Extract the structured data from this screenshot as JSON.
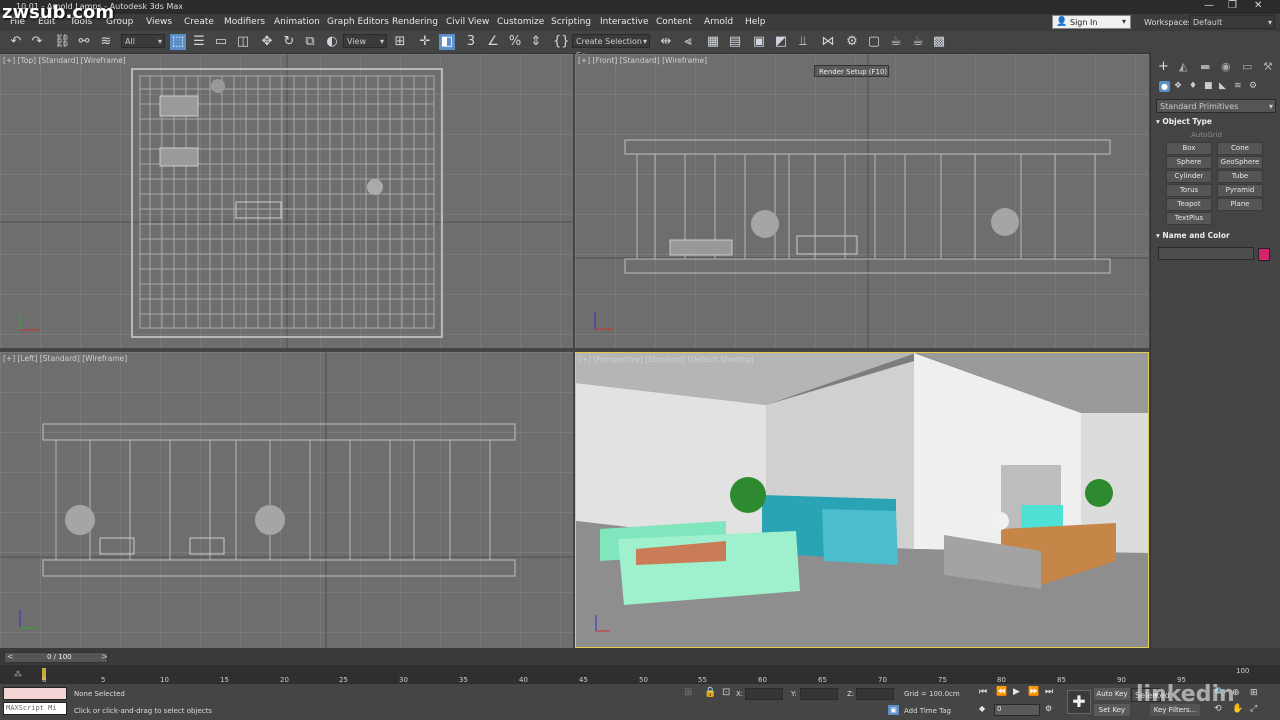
{
  "window": {
    "title": "10.01 - Arnold Lamps - Autodesk 3ds Max",
    "watermark": "zwsub.com"
  },
  "menu": [
    "File",
    "Edit",
    "Tools",
    "Group",
    "Views",
    "Create",
    "Modifiers",
    "Animation",
    "Graph Editors",
    "Rendering",
    "Civil View",
    "Customize",
    "Scripting",
    "Interactive",
    "Content",
    "Arnold",
    "Help"
  ],
  "account": {
    "signin": "Sign In",
    "workspaces_label": "Workspaces:",
    "workspace": "Default"
  },
  "toolbar": {
    "filter": "All",
    "ref_coord": "View",
    "selection_set": "Create Selection Se",
    "tooltip": "Render Setup  (F10)"
  },
  "viewports": {
    "top": "[+] [Top] [Standard] [Wireframe]",
    "front": "[+] [Front] [Standard] [Wireframe]",
    "left": "[+] [Left] [Standard] [Wireframe]",
    "perspective": "[+] [Perspective] [Standard] [Default Shading]"
  },
  "command_panel": {
    "category": "Standard Primitives",
    "object_type_title": "Object Type",
    "autogrid": "AutoGrid",
    "buttons": [
      "Box",
      "Cone",
      "Sphere",
      "GeoSphere",
      "Cylinder",
      "Tube",
      "Torus",
      "Pyramid",
      "Teapot",
      "Plane",
      "TextPlus"
    ],
    "name_color_title": "Name and Color",
    "swatch_color": "#d4246e"
  },
  "timeline": {
    "frame": "0 / 100",
    "ticks": [
      "0",
      "5",
      "10",
      "15",
      "20",
      "25",
      "30",
      "35",
      "40",
      "45",
      "50",
      "55",
      "60",
      "65",
      "70",
      "75",
      "80",
      "85",
      "90",
      "95",
      "100"
    ]
  },
  "status": {
    "maxscript": "MAXScript Mi",
    "selection": "None Selected",
    "prompt": "Click or click-and-drag to select objects",
    "x_label": "X:",
    "y_label": "Y:",
    "z_label": "Z:",
    "grid": "Grid = 100.0cm",
    "add_time_tag": "Add Time Tag",
    "auto_key": "Auto Key",
    "selected": "Selected",
    "set_key": "Set Key",
    "key_filters": "Key Filters...",
    "frame_field": "0",
    "linkedin": "linkedin"
  }
}
